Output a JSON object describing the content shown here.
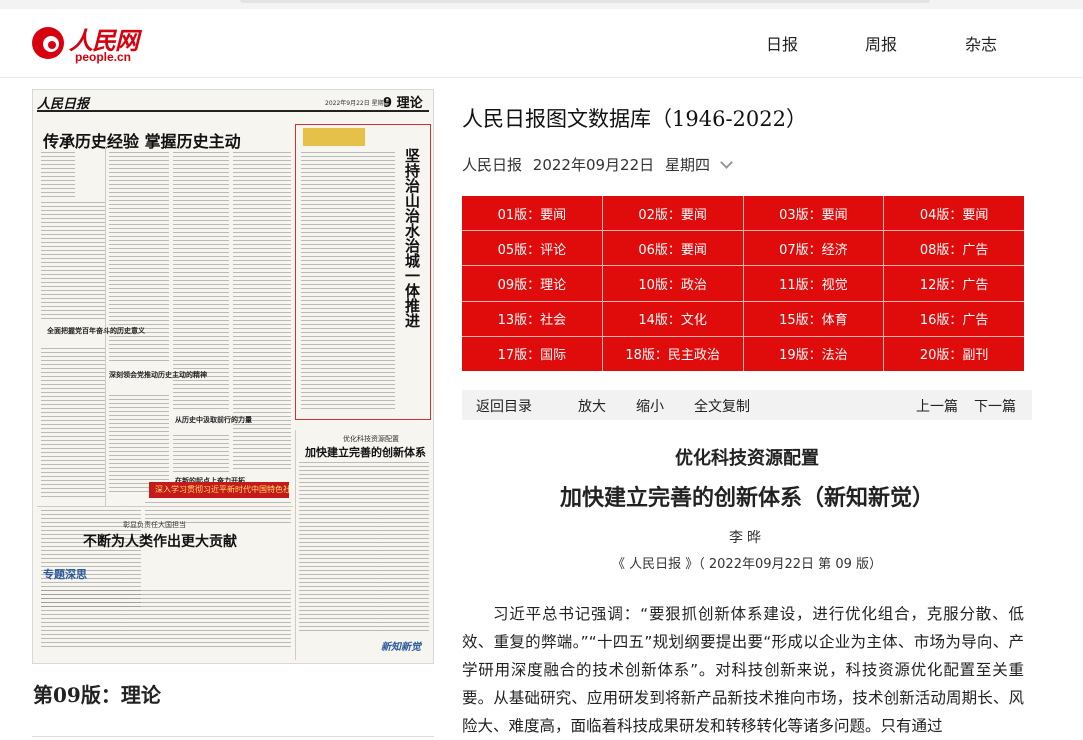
{
  "header": {
    "logo_cn": "人民网",
    "logo_en": "people.cn",
    "nav": [
      "日报",
      "周报",
      "杂志"
    ]
  },
  "paper": {
    "masthead": "人民日报",
    "date_small": "2022年9月22日 星期四",
    "page_no": "9 理论",
    "headline_main": "传承历史经验 掌握历史主动",
    "vertical_title": "坚持治山治水治城一体推进",
    "sub_small": "优化科技资源配置",
    "headline_right": "加快建立完善的创新体系",
    "banner": "深入学习贯彻习近平新时代中国特色社会主义思想",
    "headline_bottom": "不断为人类作出更大贡献",
    "sub_bottom": "彰显负责任大国担当",
    "brand_zt": "专题深思",
    "brand_zx": "新知新觉",
    "side_heads": [
      "全面把握党百年奋斗的历史意义",
      "深刻领会党推动历史主动的精神",
      "从历史中汲取前行的力量",
      "在新的起点上奋力开拓"
    ]
  },
  "page_label": "第09版：理论",
  "database_title": "人民日报图文数据库（1946-2022）",
  "dateline": {
    "paper": "人民日报",
    "date": "2022年09月22日",
    "weekday": "星期四"
  },
  "editions": [
    "01版：要闻",
    "02版：要闻",
    "03版：要闻",
    "04版：要闻",
    "05版：评论",
    "06版：要闻",
    "07版：经济",
    "08版：广告",
    "09版：理论",
    "10版：政治",
    "11版：视觉",
    "12版：广告",
    "13版：社会",
    "14版：文化",
    "15版：体育",
    "16版：广告",
    "17版：国际",
    "18版：民主政治",
    "19版：法治",
    "20版：副刊"
  ],
  "toolbar": {
    "back": "返回目录",
    "zoom_in": "放大",
    "zoom_out": "缩小",
    "copy": "全文复制",
    "prev": "上一篇",
    "next": "下一篇"
  },
  "article": {
    "kicker": "优化科技资源配置",
    "headline": "加快建立完善的创新体系（新知新觉）",
    "author": "李晔",
    "source": "《 人民日报 》（ 2022年09月22日   第 09 版）",
    "body": "习近平总书记强调：“要狠抓创新体系建设，进行优化组合，克服分散、低效、重复的弊端。”“十四五”规划纲要提出要“形成以企业为主体、市场为导向、产学研用深度融合的技术创新体系”。对科技创新来说，科技资源优化配置至关重要。从基础研究、应用研发到将新产品新技术推向市场，技术创新活动周期长、风险大、难度高，面临着科技成果研发和转移转化等诸多问题。只有通过"
  },
  "colors": {
    "brand_red": "#d6000f",
    "edition_red": "#e00c0c",
    "toolbar_bg": "#f2f2f2"
  }
}
